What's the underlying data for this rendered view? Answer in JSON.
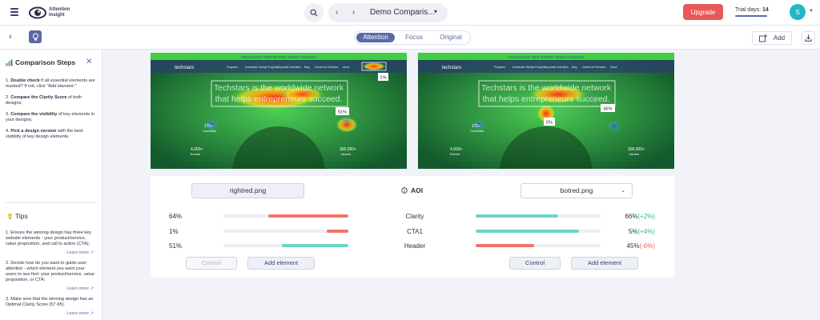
{
  "header": {
    "logo_text": "Attention Insight",
    "project_title": "Demo Comparis...",
    "upgrade_label": "Upgrade",
    "trial_label": "Trial days:",
    "trial_days": "14",
    "avatar_initial": "S"
  },
  "toolbar": {
    "tabs": [
      "Attention",
      "Focus",
      "Original"
    ],
    "active_tab": "Attention",
    "add_label": "Add"
  },
  "sidebar": {
    "title": "Comparison Steps",
    "steps": [
      {
        "num": "1.",
        "bold": "Double check",
        "text": " if all essential elements are marked? If not, click ",
        "italic": "\"Add element.\""
      },
      {
        "num": "2.",
        "bold": "Compare the Clarity Score",
        "text": " of both designs;"
      },
      {
        "num": "3.",
        "bold": "Compare the visibility",
        "text": " of key elements in your designs;"
      },
      {
        "num": "4.",
        "bold": "Pick a design version",
        "text": " with the best visibility of key design elements."
      }
    ],
    "tips_title": "Tips",
    "tips": [
      "1. Ensure the winning design has three key website elements - your product/service, value proposition, and call to action (CTA);",
      "2. Decide how do you want to guide user attention - which element you want your users to see first: your product/service, value proposition, or CTA;",
      "3. Make sure that the winning design has an Optimal Clarity Score (57-95)."
    ],
    "learn_more": "Learn more"
  },
  "screens": {
    "left": {
      "banner": "Announcement: Meet Techstars' Newest Companies!",
      "logo": "techstars",
      "nav": [
        "Programs",
        "Accelerator Startup Programs",
        "Corporate Innovation",
        "Blog",
        "Careers at Techstars",
        "About"
      ],
      "headline_1": "Techstars is the worldwide network",
      "headline_2": "that helps entrepreneurs succeed.",
      "stats": [
        {
          "num": "4,000+",
          "label": "Events"
        },
        {
          "num": "175+",
          "label": "Countries"
        },
        {
          "num": "300,000+",
          "label": "Alumni"
        }
      ],
      "labels": [
        "1%",
        "51%"
      ]
    },
    "right": {
      "banner": "Announcement: Meet Techstars' Newest Companies!",
      "logo": "techstars",
      "nav": [
        "Programs",
        "Accelerator Startup Programs",
        "Corporate Innovation",
        "Blog",
        "Careers at Techstars",
        "About"
      ],
      "headline_1": "Techstars is the worldwide network",
      "headline_2": "that helps entrepreneurs succeed.",
      "stats": [
        {
          "num": "4,000+",
          "label": "Events"
        },
        {
          "num": "175+",
          "label": "Countries"
        },
        {
          "num": "300,000+",
          "label": "Alumni"
        }
      ],
      "labels": [
        "45%",
        "5%"
      ]
    }
  },
  "comparison": {
    "left_file": "rightred.png",
    "right_file": "botred.png",
    "aoi_label": "AOI",
    "rows": [
      {
        "name": "Clarity",
        "left": "64%",
        "left_value": 0.64,
        "left_color": "#f07469",
        "right_value_text": "66%",
        "delta": "(+2%)",
        "delta_dir": "up",
        "right_value": 0.66,
        "right_color": "#6cd5c9"
      },
      {
        "name": "CTA1",
        "left": "1%",
        "left_value": 0.17,
        "left_color": "#f07469",
        "right_value_text": "5%",
        "delta": "(+4%)",
        "delta_dir": "up",
        "right_value": 0.83,
        "right_color": "#6cd5c9"
      },
      {
        "name": "Header",
        "left": "51%",
        "left_value": 0.53,
        "left_color": "#6cd5c9",
        "right_value_text": "45%",
        "delta": "(-6%)",
        "delta_dir": "down",
        "right_value": 0.47,
        "right_color": "#f07469"
      }
    ],
    "control_label": "Control",
    "add_element_label": "Add element"
  }
}
